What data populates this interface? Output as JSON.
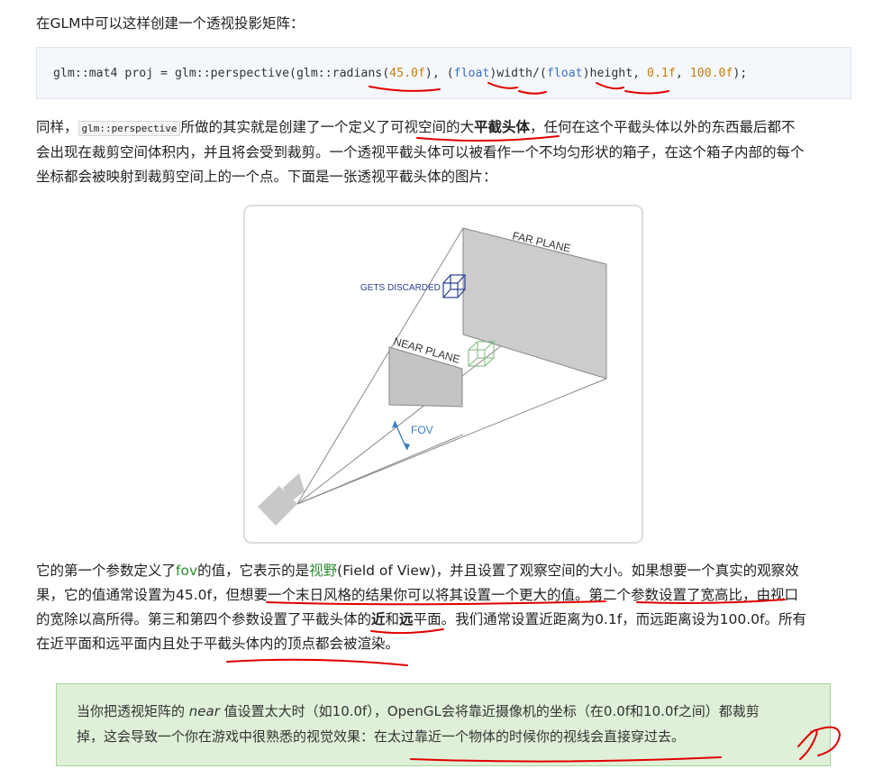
{
  "intro": "在GLM中可以这样创建一个透视投影矩阵：",
  "code": {
    "a": "glm::mat4 proj = glm::perspective(glm::radians(",
    "n1": "45.0f",
    "b": "), (",
    "k1": "float",
    "c": ")width/(",
    "k2": "float",
    "d": ")height, ",
    "n2": "0.1f",
    "e": ", ",
    "n3": "100.0f",
    "f": ");"
  },
  "para1": {
    "s1": "同样，",
    "inline": "glm::perspective",
    "s2": "所做的其实就是创建了一个定义了可视空间的大",
    "bold": "平截头体",
    "s3": "，任何在这个平截头体以外的东西最后都不",
    "l2": "会出现在裁剪空间体积内，并且将会受到裁剪。一个透视平截头体可以被看作一个不均匀形状的箱子，在这个箱子内部的每个",
    "l3": "坐标都会被映射到裁剪空间上的一个点。下面是一张透视平截头体的图片："
  },
  "figure": {
    "far_plane": "FAR PLANE",
    "near_plane": "NEAR PLANE",
    "discarded": "GETS DISCARDED",
    "fov": "FOV"
  },
  "para2": {
    "l1a": "它的第一个参数定义了",
    "fov": "fov",
    "l1b": "的值，它表示的是",
    "view": "视野",
    "l1c": "(Field of View)，并且设置了观察空间的大小。如果想要一个真实的观察效",
    "l2": "果，它的值通常设置为45.0f，但想要一个末日风格的结果你可以将其设置一个更大的值。第二个参数设置了宽高比，由视口",
    "l3a": "的宽除以高所得。第三和第四个参数设置了平截头体的",
    "near": "近",
    "and": "和",
    "far": "远",
    "l3b": "平面。我们通常设置近距离为0.1f，而远距离设为100.0f。所有",
    "l4": "在近平面和远平面内且处于平截头体内的顶点都会被渲染。"
  },
  "note": {
    "a": "当你把透视矩阵的 ",
    "near": "near",
    "b": " 值设置太大时（如10.0f），OpenGL会将靠近摄像机的坐标（在0.0f和10.0f之间）都裁剪",
    "l2": "掉，这会导致一个你在游戏中很熟悉的视觉效果：在太过靠近一个物体的时候你的视线会直接穿过去。"
  },
  "colors": {
    "link": "#2e8b2e",
    "code_number": "#c2820e",
    "code_keyword": "#3d6fc4",
    "note_bg": "#dff0d8",
    "annotation": "#e00000"
  }
}
